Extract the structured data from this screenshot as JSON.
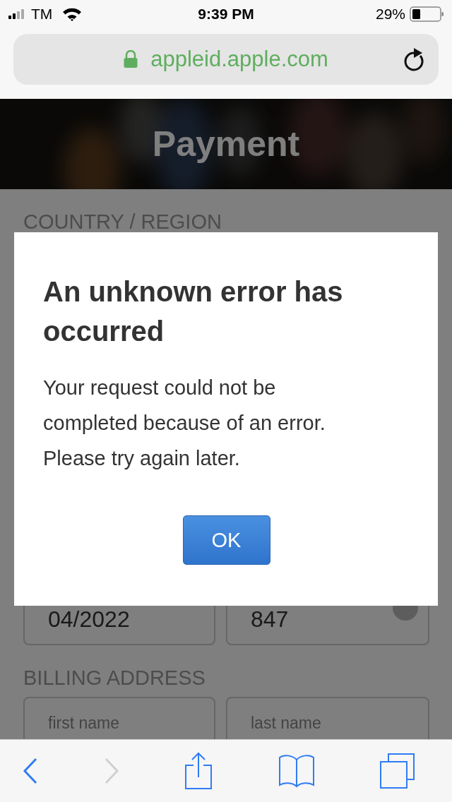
{
  "status_bar": {
    "carrier": "TM",
    "time": "9:39 PM",
    "battery": "29%"
  },
  "address_bar": {
    "url": "appleid.apple.com",
    "secure": true
  },
  "page": {
    "title": "Payment",
    "sections": [
      {
        "heading": "COUNTRY / REGION"
      },
      {
        "fields": [
          {
            "value": "04/2022",
            "info": false
          },
          {
            "value": "847",
            "info": true
          }
        ]
      },
      {
        "heading": "BILLING ADDRESS",
        "fields": [
          {
            "label": "first name",
            "info": false
          },
          {
            "label": "last name",
            "info": false
          }
        ]
      }
    ]
  },
  "dialog": {
    "title": "An unknown error has occurred",
    "message": "Your request could not be completed because of an error. Please try again later.",
    "button": "OK"
  },
  "toolbar": [
    {
      "kind": "back",
      "disabled": false
    },
    {
      "kind": "forward",
      "disabled": true
    },
    {
      "kind": "share",
      "disabled": false
    },
    {
      "kind": "bookmarks",
      "disabled": false
    },
    {
      "kind": "tabs",
      "disabled": false
    }
  ]
}
